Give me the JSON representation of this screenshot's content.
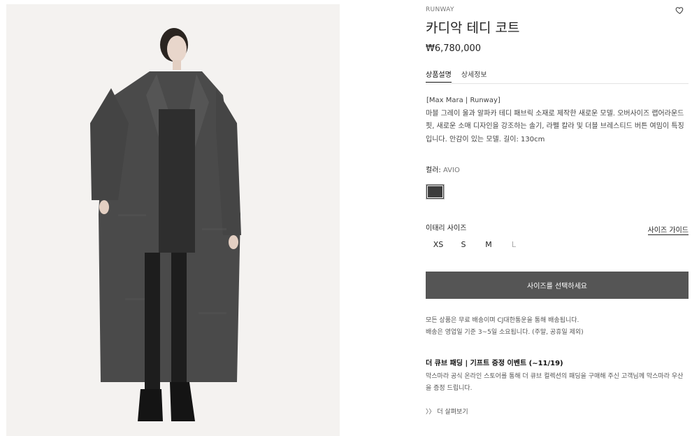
{
  "brand": "RUNWAY",
  "product": {
    "title": "카디악 테디 코트",
    "price": "₩6,780,000"
  },
  "tabs": [
    {
      "label": "상품설명",
      "active": true
    },
    {
      "label": "상세정보",
      "active": false
    }
  ],
  "description": {
    "lead": "[Max Mara | Runway]",
    "body": "마블 그레이 울과 알파카 테디 패브릭 소재로 제작한 새로운 모델. 오버사이즈 랩어라운드 핏, 새로운 소매 디자인을 강조하는 솔기, 라펠 칼라 및 더블 브레스티드 버튼 여밈이 특징입니다. 안감이 있는 모델. 길이: 130cm"
  },
  "color": {
    "label": "컬러: ",
    "value": "AVIO",
    "swatch": "#3d3d3d"
  },
  "size": {
    "label": "이태리 사이즈",
    "guide": "사이즈 가이드",
    "options": [
      {
        "label": "XS",
        "available": true
      },
      {
        "label": "S",
        "available": true
      },
      {
        "label": "M",
        "available": true
      },
      {
        "label": "L",
        "available": false
      }
    ]
  },
  "select_button": "사이즈를 선택하세요",
  "shipping": {
    "line1": "모든 상품은 무료 배송이며 CJ대한통운을 통해 배송됩니다.",
    "line2": "배송은 영업일 기준 3~5일 소요됩니다. (주말, 공휴일 제외)"
  },
  "event": {
    "title": "더 큐브 패딩 | 기프트 증정 이벤트 (~11/19)",
    "desc": "막스마라 공식 온라인 스토어를 통해 더 큐브 컬렉션의 패딩을 구매해 주신 고객님께 막스마라 우산을 증정 드립니다.",
    "more": "〉〉 더 살펴보기"
  },
  "icons": {
    "wishlist": "heart-outline-icon"
  },
  "colors": {
    "button_bg": "#555555",
    "text": "#222222"
  }
}
